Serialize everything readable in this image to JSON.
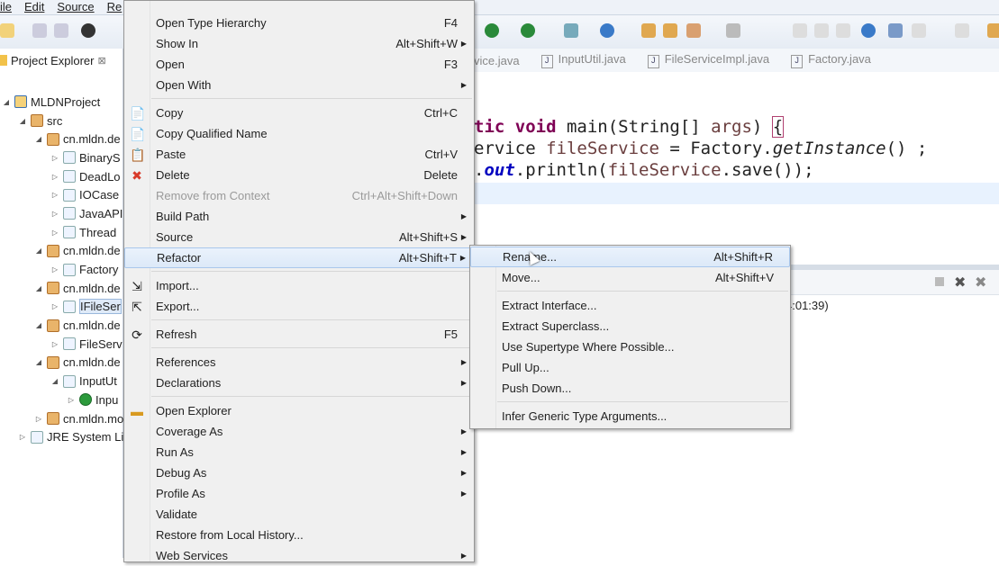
{
  "menubar": [
    "ile",
    "Edit",
    "Source",
    "Re"
  ],
  "explorer": {
    "title": "Project Explorer",
    "tree": [
      {
        "label": "MLDNProject",
        "indent": 0,
        "twisty": "open",
        "icon": "proj"
      },
      {
        "label": "src",
        "indent": 1,
        "twisty": "open",
        "icon": "pkg"
      },
      {
        "label": "cn.mldn.de",
        "indent": 2,
        "twisty": "open",
        "icon": "pkg"
      },
      {
        "label": "BinaryS",
        "indent": 3,
        "twisty": "closed",
        "icon": "java"
      },
      {
        "label": "DeadLo",
        "indent": 3,
        "twisty": "closed",
        "icon": "java"
      },
      {
        "label": "IOCase",
        "indent": 3,
        "twisty": "closed",
        "icon": "java"
      },
      {
        "label": "JavaAPI",
        "indent": 3,
        "twisty": "closed",
        "icon": "java"
      },
      {
        "label": "Thread",
        "indent": 3,
        "twisty": "closed",
        "icon": "java"
      },
      {
        "label": "cn.mldn.de",
        "indent": 2,
        "twisty": "open",
        "icon": "pkg"
      },
      {
        "label": "Factory",
        "indent": 3,
        "twisty": "closed",
        "icon": "java"
      },
      {
        "label": "cn.mldn.de",
        "indent": 2,
        "twisty": "open",
        "icon": "pkg"
      },
      {
        "label": "IFileSer",
        "indent": 3,
        "twisty": "closed",
        "icon": "java",
        "selected": true
      },
      {
        "label": "cn.mldn.de",
        "indent": 2,
        "twisty": "open",
        "icon": "pkg"
      },
      {
        "label": "FileServ",
        "indent": 3,
        "twisty": "closed",
        "icon": "java"
      },
      {
        "label": "cn.mldn.de",
        "indent": 2,
        "twisty": "open",
        "icon": "pkg"
      },
      {
        "label": "InputUt",
        "indent": 3,
        "twisty": "open",
        "icon": "java"
      },
      {
        "label": "Inpu",
        "indent": 4,
        "twisty": "closed",
        "icon": "cls"
      },
      {
        "label": "cn.mldn.mo",
        "indent": 2,
        "twisty": "closed",
        "icon": "pkg"
      },
      {
        "label": "JRE System Lil",
        "indent": 1,
        "twisty": "closed",
        "icon": "lib"
      }
    ]
  },
  "editor": {
    "tabs": [
      "vice.java",
      "InputUtil.java",
      "FileServiceImpl.java",
      "Factory.java"
    ]
  },
  "bottom": {
    "text": "4:01:39)"
  },
  "context_menu": [
    {
      "label": "Open Type Hierarchy",
      "shortcut": "F4"
    },
    {
      "label": "Show In",
      "shortcut": "Alt+Shift+W",
      "submenu": true
    },
    {
      "label": "Open",
      "shortcut": "F3"
    },
    {
      "label": "Open With",
      "submenu": true
    },
    {
      "sep": true
    },
    {
      "label": "Copy",
      "shortcut": "Ctrl+C",
      "icon": "copy-icon",
      "glyph": "📄"
    },
    {
      "label": "Copy Qualified Name",
      "icon": "copy-qualified-name-icon",
      "glyph": "📄"
    },
    {
      "label": "Paste",
      "shortcut": "Ctrl+V",
      "icon": "paste-icon",
      "glyph": "📋"
    },
    {
      "label": "Delete",
      "shortcut": "Delete",
      "icon": "delete-icon",
      "glyph": "✖",
      "color": "#d83a2a"
    },
    {
      "label": "Remove from Context",
      "shortcut": "Ctrl+Alt+Shift+Down",
      "disabled": true
    },
    {
      "label": "Build Path",
      "submenu": true
    },
    {
      "label": "Source",
      "shortcut": "Alt+Shift+S",
      "submenu": true
    },
    {
      "label": "Refactor",
      "shortcut": "Alt+Shift+T",
      "submenu": true,
      "highlighted": true
    },
    {
      "sep": true
    },
    {
      "label": "Import...",
      "icon": "import-icon",
      "glyph": "⇲"
    },
    {
      "label": "Export...",
      "icon": "export-icon",
      "glyph": "⇱"
    },
    {
      "sep": true
    },
    {
      "label": "Refresh",
      "shortcut": "F5",
      "icon": "refresh-icon",
      "glyph": "⟳"
    },
    {
      "sep": true
    },
    {
      "label": "References",
      "submenu": true
    },
    {
      "label": "Declarations",
      "submenu": true
    },
    {
      "sep": true
    },
    {
      "label": "Open Explorer",
      "icon": "open-explorer-icon",
      "glyph": "▬",
      "color": "#d89a20"
    },
    {
      "label": "Coverage As",
      "submenu": true
    },
    {
      "label": "Run As",
      "submenu": true
    },
    {
      "label": "Debug As",
      "submenu": true
    },
    {
      "label": "Profile As",
      "submenu": true
    },
    {
      "label": "Validate"
    },
    {
      "label": "Restore from Local History..."
    },
    {
      "label": "Web Services",
      "submenu": true
    }
  ],
  "refactor_submenu": [
    {
      "label": "Rename...",
      "shortcut": "Alt+Shift+R",
      "highlighted": true
    },
    {
      "label": "Move...",
      "shortcut": "Alt+Shift+V"
    },
    {
      "sep": true
    },
    {
      "label": "Extract Interface..."
    },
    {
      "label": "Extract Superclass..."
    },
    {
      "label": "Use Supertype Where Possible..."
    },
    {
      "label": "Pull Up..."
    },
    {
      "label": "Push Down..."
    },
    {
      "sep": true
    },
    {
      "label": "Infer Generic Type Arguments..."
    }
  ]
}
